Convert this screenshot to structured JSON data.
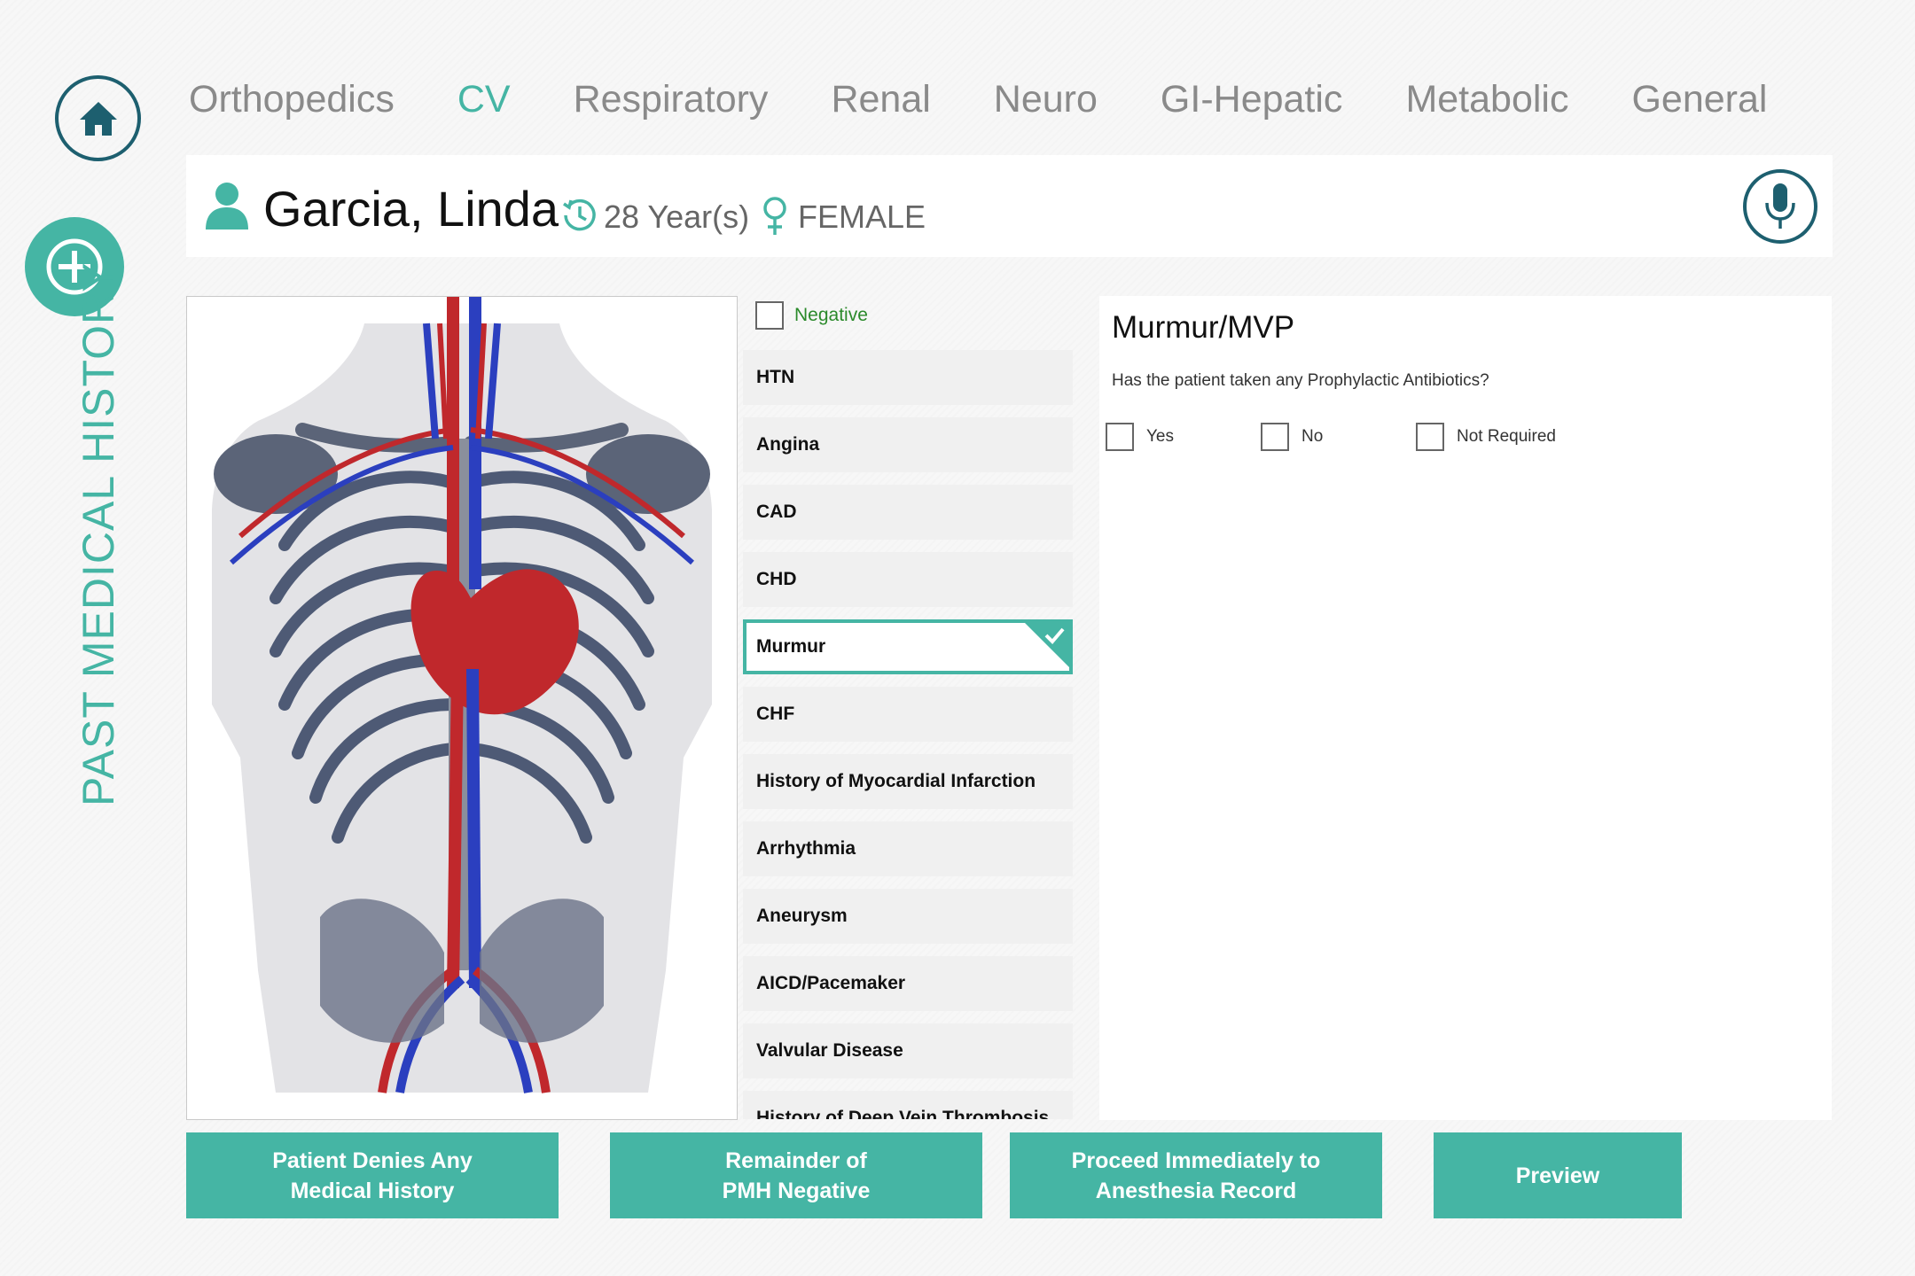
{
  "nav": {
    "tabs": [
      "Orthopedics",
      "CV",
      "Respiratory",
      "Renal",
      "Neuro",
      "GI-Hepatic",
      "Metabolic",
      "General"
    ],
    "active": "CV"
  },
  "sidebar": {
    "title": "PAST MEDICAL HISTORY"
  },
  "patient": {
    "name": "Garcia, Linda",
    "age": "28 Year(s)",
    "gender": "FEMALE"
  },
  "conditions": {
    "negative_label": "Negative",
    "items": [
      "HTN",
      "Angina",
      "CAD",
      "CHD",
      "Murmur",
      "CHF",
      "History of Myocardial Infarction",
      "Arrhythmia",
      "Aneurysm",
      "AICD/Pacemaker",
      "Valvular Disease",
      "History of Deep Vein Thrombosis"
    ],
    "selected": "Murmur"
  },
  "question": {
    "title": "Murmur/MVP",
    "text": "Has the patient taken any Prophylactic Antibiotics?",
    "options": [
      "Yes",
      "No",
      "Not Required"
    ]
  },
  "actions": {
    "deny": [
      "Patient Denies Any",
      "Medical History"
    ],
    "remainder": [
      "Remainder of",
      "PMH Negative"
    ],
    "proceed": [
      "Proceed Immediately to",
      "Anesthesia Record"
    ],
    "preview": "Preview"
  },
  "colors": {
    "accent": "#45b5a4",
    "dark_accent": "#1d5f6f",
    "negative_text": "#2b8a2b"
  }
}
